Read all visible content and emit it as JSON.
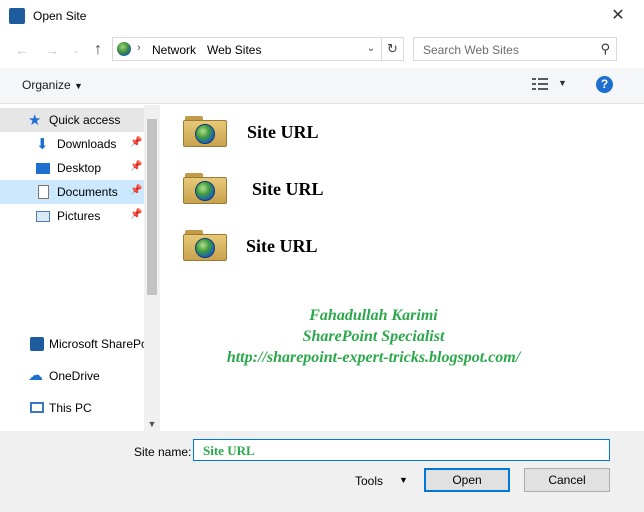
{
  "window": {
    "title": "Open Site"
  },
  "nav": {
    "address": {
      "segment_1": "Network",
      "segment_2": "Web Sites"
    },
    "search_placeholder": "Search Web Sites"
  },
  "toolbar": {
    "organize_label": "Organize"
  },
  "sidebar": {
    "items": [
      {
        "label": "Quick access",
        "icon": "star-icon",
        "pinned": false
      },
      {
        "label": "Downloads",
        "icon": "download-arrow-icon",
        "pinned": true
      },
      {
        "label": "Desktop",
        "icon": "desktop-icon",
        "pinned": true
      },
      {
        "label": "Documents",
        "icon": "documents-icon",
        "pinned": true
      },
      {
        "label": "Pictures",
        "icon": "pictures-icon",
        "pinned": true
      },
      {
        "label": "Microsoft SharePo",
        "icon": "sharepoint-icon",
        "pinned": false
      },
      {
        "label": "OneDrive",
        "icon": "cloud-icon",
        "pinned": false
      },
      {
        "label": "This PC",
        "icon": "computer-icon",
        "pinned": false
      }
    ]
  },
  "content": {
    "folders": [
      {
        "label": "Site URL"
      },
      {
        "label": "Site URL"
      },
      {
        "label": "Site URL"
      }
    ],
    "credit": {
      "line1": "Fahadullah Karimi",
      "line2": "SharePoint Specialist",
      "line3": "http://sharepoint-expert-tricks.blogspot.com/"
    }
  },
  "footer": {
    "site_name_label": "Site name:",
    "site_name_value": "Site URL",
    "tools_label": "Tools",
    "open_label": "Open",
    "cancel_label": "Cancel"
  },
  "colors": {
    "accent": "#0078d7",
    "credit_green": "#2aa84a",
    "selection": "#cce8ff"
  }
}
